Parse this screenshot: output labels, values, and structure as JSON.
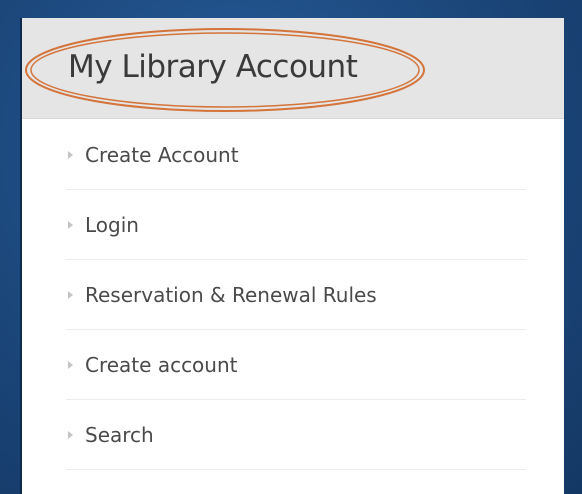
{
  "panel": {
    "title": "My Library Account",
    "highlight_color": "#d4743a"
  },
  "menu": {
    "items": [
      {
        "label": "Create Account",
        "icon": "arrow-right-icon"
      },
      {
        "label": "Login",
        "icon": "arrow-right-icon"
      },
      {
        "label": "Reservation & Renewal Rules",
        "icon": "arrow-right-icon"
      },
      {
        "label": "Create account",
        "icon": "arrow-right-icon"
      },
      {
        "label": "Search",
        "icon": "arrow-right-icon"
      }
    ]
  }
}
